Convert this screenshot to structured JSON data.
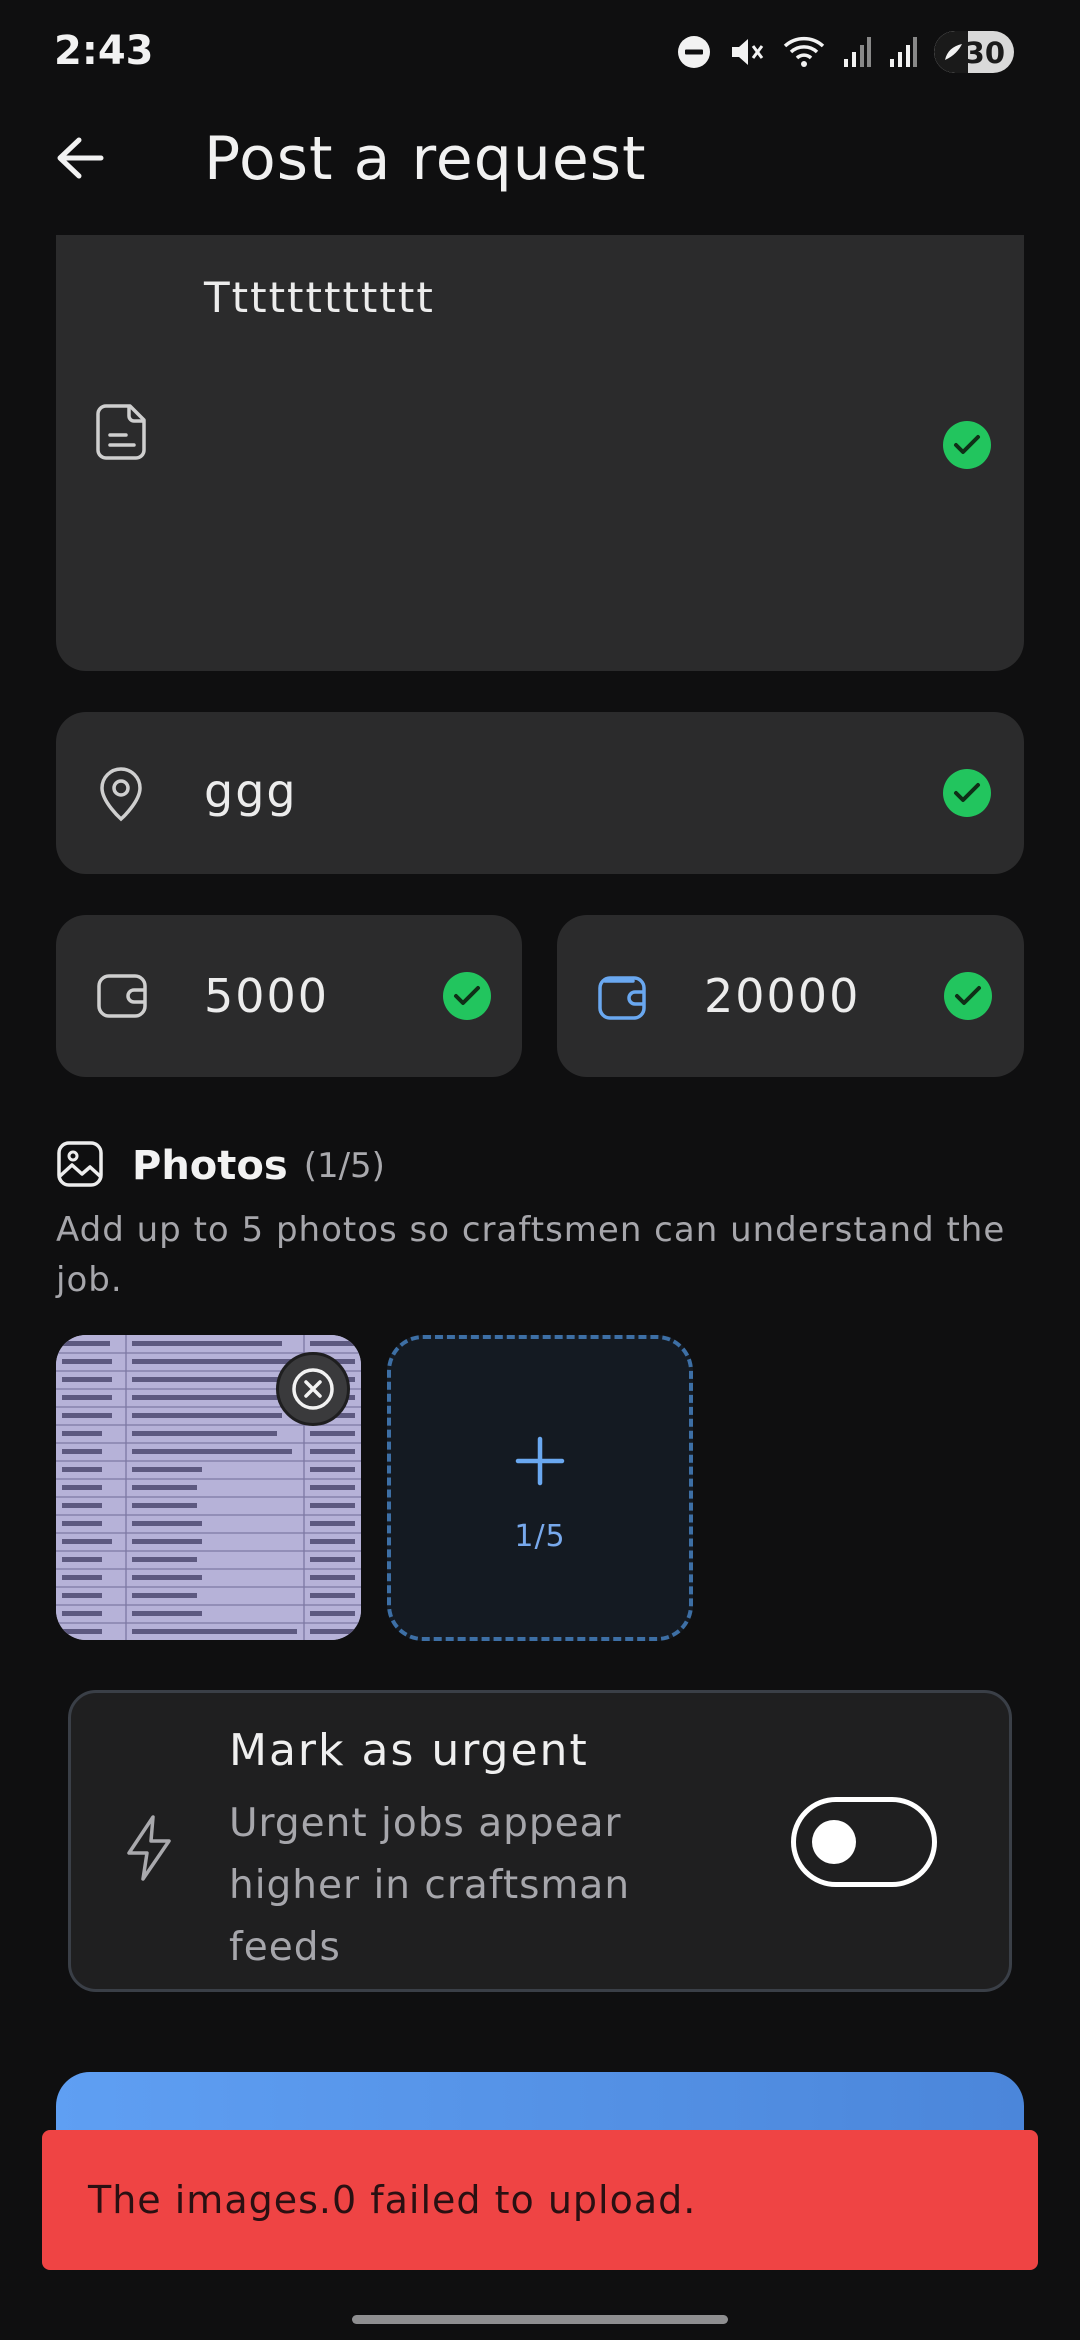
{
  "status_bar": {
    "time": "2:43",
    "battery": "30",
    "icons": [
      "do-not-disturb-icon",
      "mute-icon",
      "wifi-icon",
      "signal-icon",
      "signal-icon",
      "battery-saver-icon"
    ]
  },
  "app_bar": {
    "title": "Post a request",
    "back_icon": "arrow-left-icon"
  },
  "form": {
    "description": {
      "value": "Tttttttttttt",
      "icon": "document-icon",
      "valid": true
    },
    "location": {
      "value": "ggg",
      "icon": "location-pin-icon",
      "valid": true
    },
    "budget_min": {
      "value": "5000",
      "icon": "wallet-icon",
      "valid": true
    },
    "budget_max": {
      "value": "20000",
      "icon": "wallet-icon",
      "valid": true
    }
  },
  "photos": {
    "title": "Photos",
    "count": "(1/5)",
    "help": "Add up to 5 photos so craftsmen can understand the job.",
    "add_tile_count": "1/5",
    "uploaded": 1
  },
  "urgent": {
    "title": "Mark as urgent",
    "subtitle": "Urgent jobs appear higher in craftsman feeds",
    "enabled": false,
    "icon": "lightning-icon"
  },
  "snackbar": {
    "message": "The images.0 failed to upload."
  },
  "colors": {
    "background": "#0f0f10",
    "card": "#2b2b2c",
    "success": "#22c55e",
    "accent": "#5f9ff3",
    "error": "#ef4444"
  }
}
